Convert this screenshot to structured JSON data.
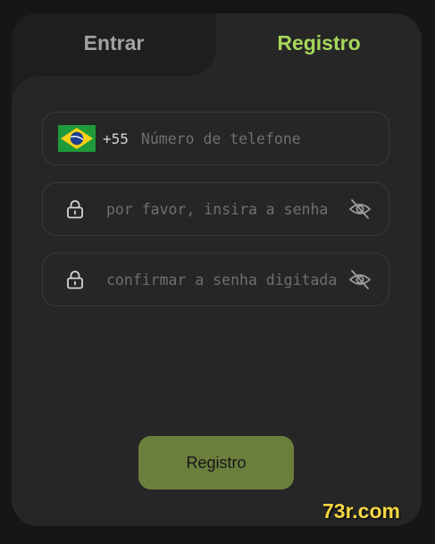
{
  "tabs": {
    "login_label": "Entrar",
    "register_label": "Registro",
    "active": "register"
  },
  "phone": {
    "country_flag": "brazil-flag-icon",
    "country_code": "+55",
    "placeholder": "Número de telefone",
    "value": ""
  },
  "password": {
    "placeholder": "por favor, insira a senha",
    "value": ""
  },
  "confirm_password": {
    "placeholder": "confirmar a senha digitada",
    "value": ""
  },
  "submit_label": "Registro",
  "watermark": "73r.com",
  "colors": {
    "background": "#161616",
    "card": "#262626",
    "inactive_tab": "#1e1e1e",
    "accent": "#a6d65c",
    "button": "#6b7f3d",
    "watermark": "#f5d742"
  }
}
